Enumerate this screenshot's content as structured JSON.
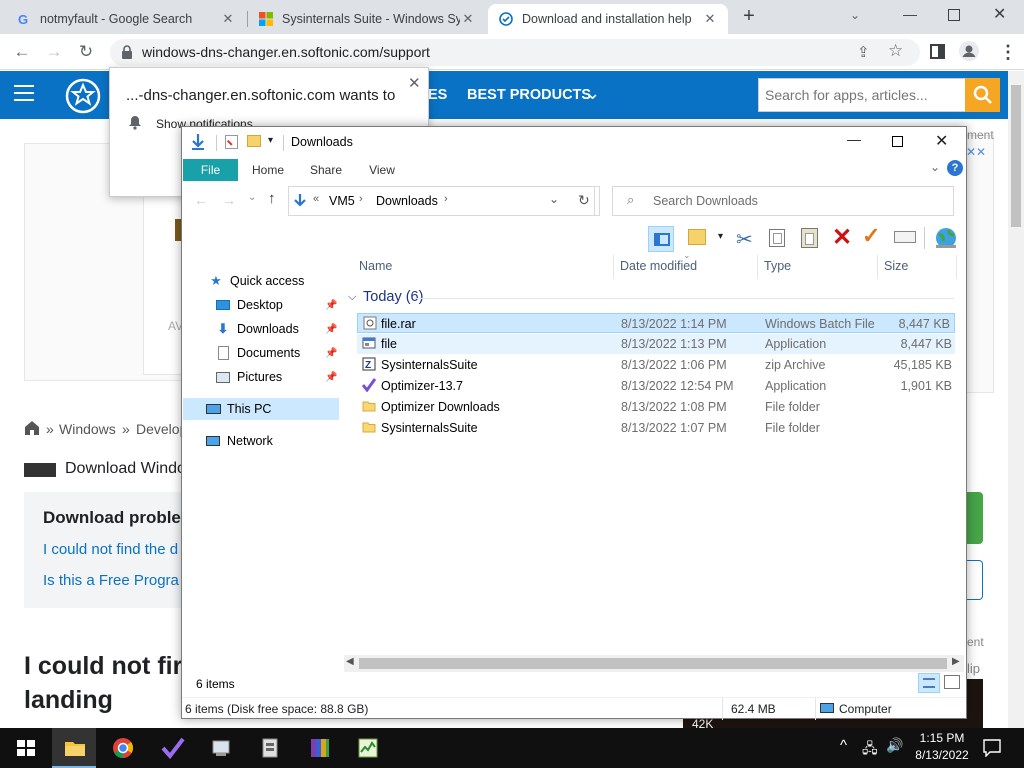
{
  "browser": {
    "tabs": [
      {
        "title": "notmyfault - Google Search"
      },
      {
        "title": "Sysinternals Suite - Windows Sys"
      },
      {
        "title": "Download and installation help"
      }
    ],
    "url": "windows-dns-changer.en.softonic.com/support"
  },
  "notification": {
    "title": "...-dns-changer.en.softonic.com wants to",
    "item": "Show notifications"
  },
  "site": {
    "nav_partial": "ES",
    "nav_best": "BEST PRODUCTS",
    "search_placeholder": "Search for apps, articles...",
    "breadcrumb_home": "Windows",
    "breadcrumb_next": "Develop",
    "download_title": "Download Windo",
    "problem_heading": "Download proble",
    "link1": "I could not find the d",
    "link2": "Is this a Free Progra",
    "headline_line1": "I could not fir",
    "headline_line2": "landing",
    "side_ad": "ment",
    "side_ad2": "ent",
    "side_ad3": "lip",
    "left_av": "AV",
    "thumb_count": "42K"
  },
  "explorer": {
    "title": "Downloads",
    "ribbon_tabs": [
      "File",
      "Home",
      "Share",
      "View"
    ],
    "path": [
      "VM5",
      "Downloads"
    ],
    "search_placeholder": "Search Downloads",
    "nav": {
      "quick_access": "Quick access",
      "desktop": "Desktop",
      "downloads": "Downloads",
      "documents": "Documents",
      "pictures": "Pictures",
      "this_pc": "This PC",
      "network": "Network"
    },
    "columns": {
      "name": "Name",
      "date": "Date modified",
      "type": "Type",
      "size": "Size"
    },
    "group": "Today (6)",
    "files": [
      {
        "name": "file.rar",
        "date": "8/13/2022 1:14 PM",
        "type": "Windows Batch File",
        "size": "8,447 KB"
      },
      {
        "name": "file",
        "date": "8/13/2022 1:13 PM",
        "type": "Application",
        "size": "8,447 KB"
      },
      {
        "name": "SysinternalsSuite",
        "date": "8/13/2022 1:06 PM",
        "type": "zip Archive",
        "size": "45,185 KB"
      },
      {
        "name": "Optimizer-13.7",
        "date": "8/13/2022 12:54 PM",
        "type": "Application",
        "size": "1,901 KB"
      },
      {
        "name": "Optimizer Downloads",
        "date": "8/13/2022 1:08 PM",
        "type": "File folder",
        "size": ""
      },
      {
        "name": "SysinternalsSuite",
        "date": "8/13/2022 1:07 PM",
        "type": "File folder",
        "size": ""
      }
    ],
    "item_count": "6 items",
    "status_left": "6 items (Disk free space: 88.8 GB)",
    "status_size": "62.4 MB",
    "status_location": "Computer"
  },
  "taskbar": {
    "time": "1:15 PM",
    "date": "8/13/2022"
  }
}
